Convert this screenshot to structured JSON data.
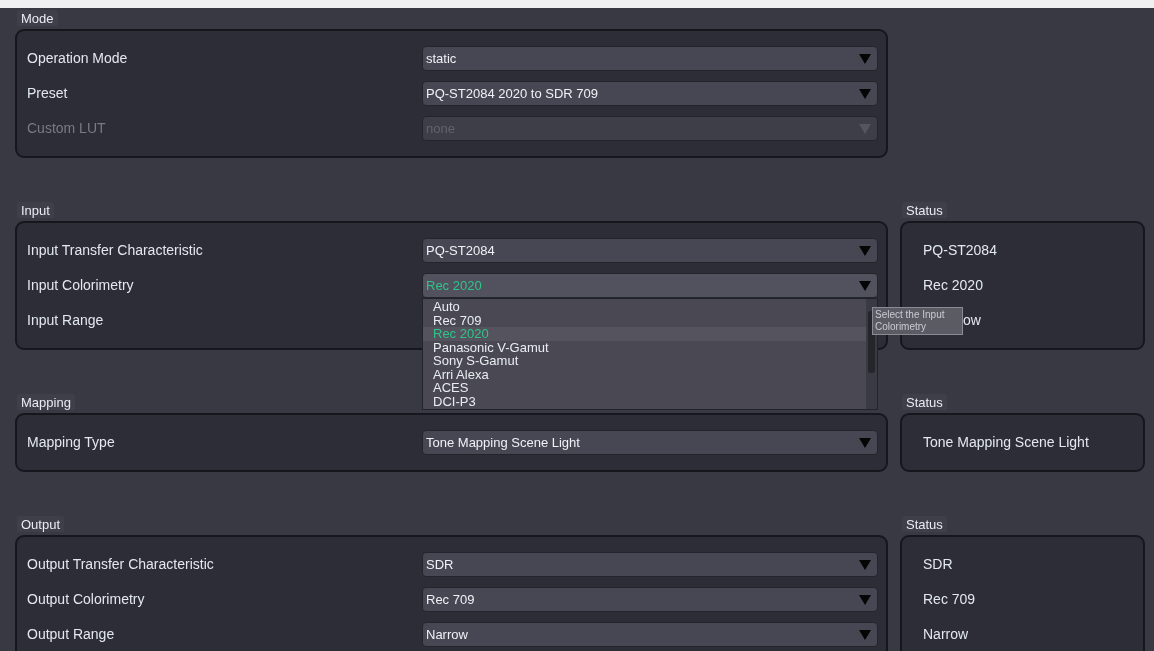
{
  "sections": [
    {
      "title": "Mode",
      "rows": [
        {
          "label": "Operation Mode",
          "value": "static",
          "disabled": false,
          "open": false
        },
        {
          "label": "Preset",
          "value": "PQ-ST2084 2020 to SDR 709",
          "disabled": false,
          "open": false
        },
        {
          "label": "Custom LUT",
          "value": "none",
          "disabled": true,
          "open": false
        }
      ]
    },
    {
      "title": "Input",
      "rows": [
        {
          "label": "Input Transfer Characteristic",
          "value": "PQ-ST2084",
          "disabled": false,
          "open": false
        },
        {
          "label": "Input Colorimetry",
          "value": "Rec 2020",
          "disabled": false,
          "open": true
        },
        {
          "label": "Input Range",
          "disabled": false,
          "open": false
        }
      ],
      "status": {
        "title": "Status",
        "items": [
          {
            "text": "PQ-ST2084"
          },
          {
            "text": "Rec 2020"
          },
          {
            "text": "ow",
            "tooltip": "Select the Input Colorimetry"
          }
        ]
      }
    },
    {
      "title": "Mapping",
      "rows": [
        {
          "label": "Mapping Type",
          "value": "Tone Mapping Scene Light",
          "disabled": false,
          "open": false
        }
      ],
      "status": {
        "title": "Status",
        "items": [
          {
            "text": "Tone Mapping Scene Light"
          }
        ]
      }
    },
    {
      "title": "Output",
      "rows": [
        {
          "label": "Output Transfer Characteristic",
          "value": "SDR",
          "disabled": false,
          "open": false
        },
        {
          "label": "Output Colorimetry",
          "value": "Rec 709",
          "disabled": false,
          "open": false
        },
        {
          "label": "Output Range",
          "value": "Narrow",
          "disabled": false,
          "open": false
        }
      ],
      "status": {
        "title": "Status",
        "items": [
          {
            "text": "SDR"
          },
          {
            "text": "Rec 709"
          },
          {
            "text": "Narrow"
          }
        ]
      }
    }
  ],
  "dropdown_list": {
    "options": [
      {
        "label": "Auto",
        "selected": false
      },
      {
        "label": "Rec 709",
        "selected": false
      },
      {
        "label": "Rec 2020",
        "selected": true
      },
      {
        "label": "Panasonic V-Gamut",
        "selected": false
      },
      {
        "label": "Sony S-Gamut",
        "selected": false
      },
      {
        "label": "Arri Alexa",
        "selected": false
      },
      {
        "label": "ACES",
        "selected": false
      },
      {
        "label": "DCI-P3",
        "selected": false
      }
    ]
  }
}
